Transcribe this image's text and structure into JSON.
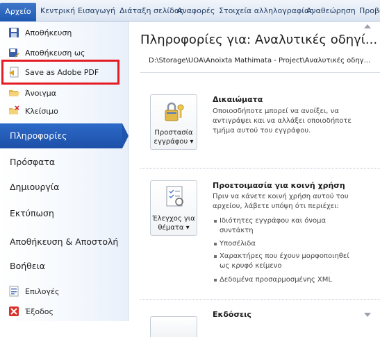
{
  "ribbon": {
    "file_tab": "Αρχείο",
    "tabs": [
      "Κεντρική",
      "Εισαγωγή",
      "Διάταξη σελίδας",
      "Αναφορές",
      "Στοιχεία αλληλογραφίας",
      "Αναθεώρηση",
      "Προβο"
    ]
  },
  "left": {
    "commands": [
      {
        "label": "Αποθήκευση",
        "icon": "save-icon"
      },
      {
        "label": "Αποθήκευση ως",
        "icon": "save-as-icon"
      },
      {
        "label": "Save as Adobe PDF",
        "icon": "pdf-icon"
      },
      {
        "label": "Άνοιγμα",
        "icon": "open-folder-icon"
      },
      {
        "label": "Κλείσιμο",
        "icon": "close-folder-icon"
      }
    ],
    "sections": [
      "Πληροφορίες",
      "Πρόσφατα",
      "Δημιουργία",
      "Εκτύπωση",
      "Αποθήκευση & Αποστολή",
      "Βοήθεια"
    ],
    "active_section": "Πληροφορίες",
    "bottom": [
      {
        "label": "Επιλογές",
        "icon": "options-icon"
      },
      {
        "label": "Έξοδος",
        "icon": "exit-icon"
      }
    ],
    "highlight_color": "#e51c24"
  },
  "main": {
    "title": "Πληροφορίες για: Αναλυτικές οδηγί...",
    "path": "D:\\Storage\\UOA\\Anoixta Mathimata - Project\\Αναλυτικές οδηγ...",
    "permissions": {
      "button_line1": "Προστασία",
      "button_line2": "εγγράφου",
      "heading": "Δικαιώματα",
      "text": "Οποιοσδήποτε μπορεί να ανοίξει, να αντιγράψει και να αλλάξει οποιοδήποτε τμήμα αυτού του εγγράφου."
    },
    "sharing": {
      "button_line1": "Έλεγχος για",
      "button_line2": "θέματα",
      "heading": "Προετοιμασία για κοινή χρήση",
      "text": "Πριν να κάνετε κοινή χρήση αυτού του αρχείου, λάβετε υπόψη ότι περιέχει:",
      "items": [
        "Ιδιότητες εγγράφου και όνομα συντάκτη",
        "Υποσέλιδα",
        "Χαρακτήρες που έχουν μορφοποιηθεί ως κρυφό κείμενο",
        "Δεδομένα προσαρμοσμένης XML"
      ]
    },
    "versions": {
      "heading": "Εκδόσεις"
    }
  },
  "colors": {
    "active_bg": "#1f55ad",
    "file_tab": "#2a62bb",
    "ribbon_text": "#1f3b63"
  }
}
